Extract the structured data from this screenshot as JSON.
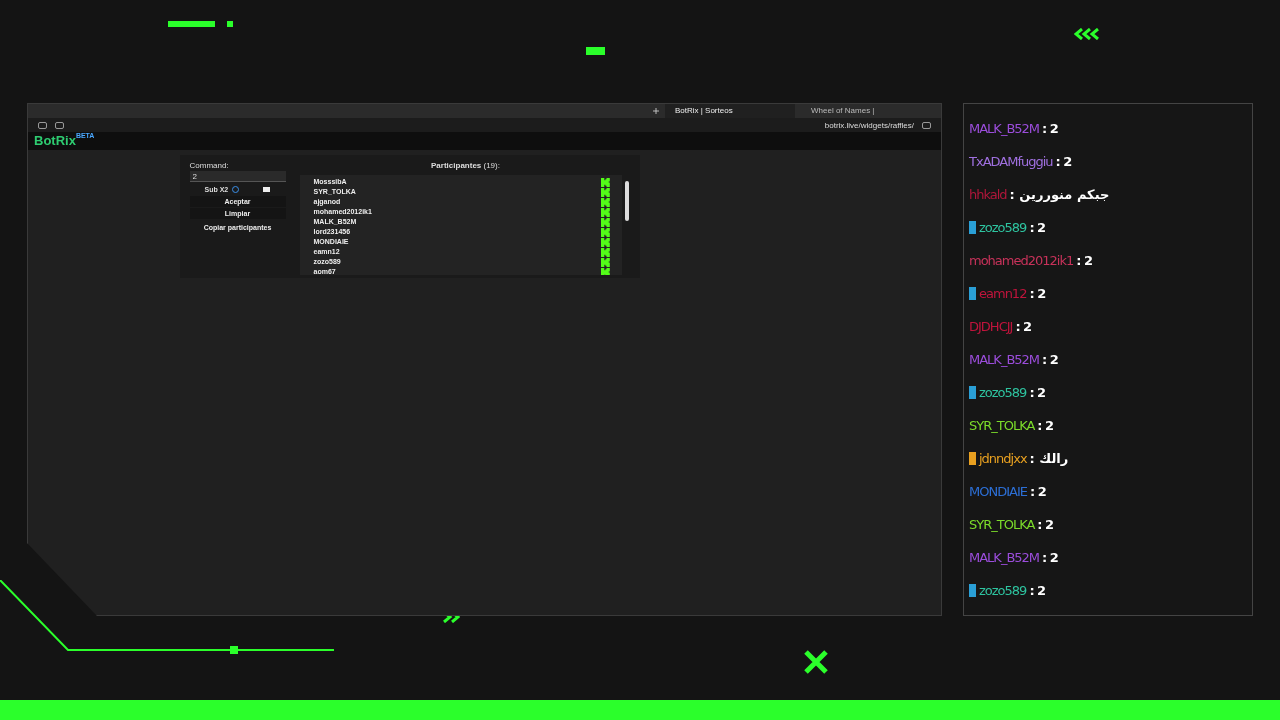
{
  "browser": {
    "tabs": [
      {
        "label": "BotRix | Sorteos",
        "selected": true
      },
      {
        "label": "Wheel of Names |",
        "selected": false
      }
    ],
    "address": "botrix.live/widgets/raffles/"
  },
  "app": {
    "logo": "BotRix",
    "logo_badge": "BETA",
    "controls": {
      "command_label": "Command:",
      "command_value": "2",
      "sub_label": "Sub X2",
      "sub_checked": false,
      "buttons": [
        "Aceptar",
        "Limpiar",
        "Copiar participantes"
      ]
    },
    "participants": {
      "title": "Participantes",
      "count": "(19):",
      "names": [
        "MosssibA",
        "SYR_TOLKA",
        "ajganod",
        "mohamed2012ik1",
        "MALK_B52M",
        "lord231456",
        "MONDIAIE",
        "eamn12",
        "zozo589",
        "aom67"
      ]
    }
  },
  "chat": [
    {
      "name": "MALK_B52M",
      "color": "#9b4ddb",
      "message": ": 2"
    },
    {
      "name": "TxADAMfuggiu",
      "color": "#a070e0",
      "message": ": 2"
    },
    {
      "name": "hhkald",
      "color": "#b0163a",
      "message": ": جبكم منوررين"
    },
    {
      "name": "zozo589",
      "color": "#2ec4a0",
      "message": ": 2",
      "badge": {
        "color": "#2a9fd6"
      }
    },
    {
      "name": "mohamed2012ik1",
      "color": "#c8325a",
      "message": ": 2"
    },
    {
      "name": "eamn12",
      "color": "#c0143c",
      "message": ": 2",
      "badge": {
        "color": "#2a9fd6"
      }
    },
    {
      "name": "DJDHCJJ",
      "color": "#c0143c",
      "message": ": 2"
    },
    {
      "name": "MALK_B52M",
      "color": "#9b4ddb",
      "message": ": 2"
    },
    {
      "name": "zozo589",
      "color": "#2ec4a0",
      "message": ": 2",
      "badge": {
        "color": "#2a9fd6"
      }
    },
    {
      "name": "SYR_TOLKA",
      "color": "#7cdc2a",
      "message": ": 2"
    },
    {
      "name": "jdnndjxx",
      "color": "#e8a020",
      "message": ": رالك",
      "badge": {
        "color": "#e8a020"
      }
    },
    {
      "name": "MONDIAIE",
      "color": "#2c6fd6",
      "message": ": 2"
    },
    {
      "name": "SYR_TOLKA",
      "color": "#7cdc2a",
      "message": ": 2"
    },
    {
      "name": "MALK_B52M",
      "color": "#9b4ddb",
      "message": ": 2"
    },
    {
      "name": "zozo589",
      "color": "#2ec4a0",
      "message": ": 2",
      "badge": {
        "color": "#2a9fd6"
      }
    }
  ]
}
